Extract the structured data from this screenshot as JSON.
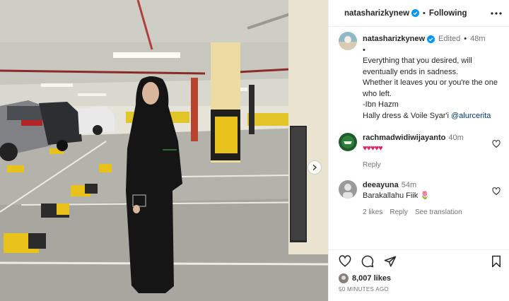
{
  "post": {
    "username": "natasharizkynew",
    "follow_label": "Following",
    "edited_label": "Edited",
    "time": "48m",
    "caption_lines": [
      "•",
      "Everything that you desired, will",
      "eventually ends in sadness.",
      "Whether it leaves you or you're the one",
      "who left.",
      "",
      "-Ibn Hazm",
      "",
      "Hally dress & Voile Syar'i "
    ],
    "mention": "@alurcerita",
    "likes": "8,007 likes",
    "posted_ago": "50 MINUTES AGO"
  },
  "comments": [
    {
      "user": "rachmadwidiwijayanto",
      "time": "40m",
      "text": "♥♥♥♥♥",
      "reply_label": "Reply"
    },
    {
      "user": "deeayuna",
      "time": "54m",
      "text": "Barakallahu Fiik 🌷",
      "likes": "2 likes",
      "reply_label": "Reply",
      "translate_label": "See translation"
    }
  ],
  "colors": {
    "verified": "#0095f6",
    "heart": "#ed4956",
    "link": "#00376b",
    "pillar_yellow": "#e8c21a"
  },
  "icons": [
    "verified-badge-icon",
    "more-icon",
    "heart-icon",
    "comment-icon",
    "share-icon",
    "bookmark-icon",
    "chevron-right-icon"
  ]
}
